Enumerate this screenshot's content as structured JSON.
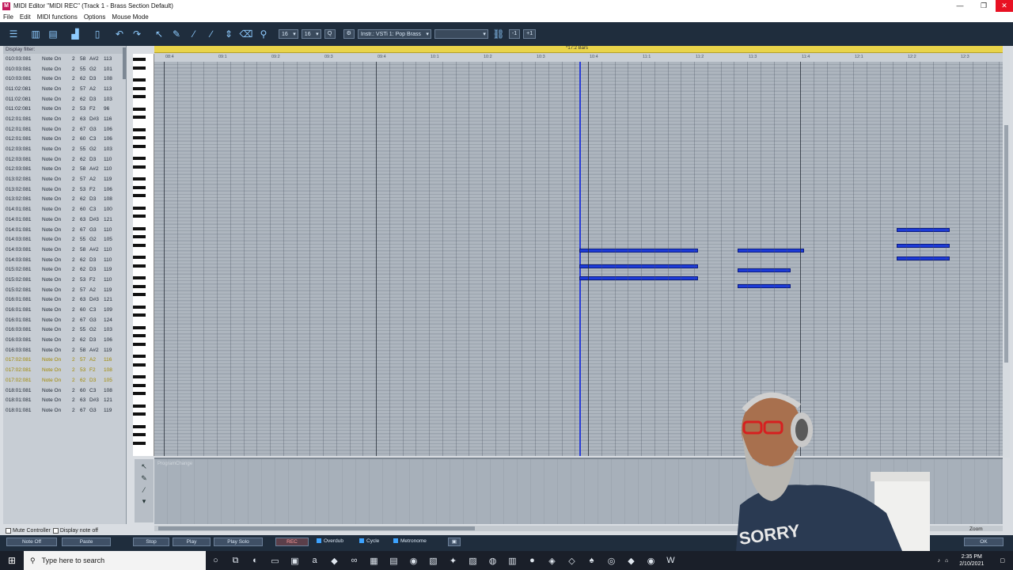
{
  "window": {
    "title": "MIDI Editor \"MIDI REC\"  (Track 1 - Brass Section Default)",
    "app_icon": "M"
  },
  "menu": [
    "File",
    "Edit",
    "MIDI functions",
    "Options",
    "Mouse Mode"
  ],
  "toolbar": {
    "quantize_1": "16",
    "quantize_2": "16",
    "q_label": "Q",
    "instrument": "Instr.: VSTi 1: Pop Brass",
    "blank_select": "",
    "minus": "-1",
    "plus": "+1"
  },
  "event_list": {
    "filter_label": "Display filter:",
    "rows": [
      [
        "010:03:081",
        "Note On",
        "2",
        "58",
        "A#2",
        "113"
      ],
      [
        "010:03:081",
        "Note On",
        "2",
        "55",
        "G2",
        "101"
      ],
      [
        "010:03:081",
        "Note On",
        "2",
        "62",
        "D3",
        "108"
      ],
      [
        "011:02:081",
        "Note On",
        "2",
        "57",
        "A2",
        "113"
      ],
      [
        "011:02:081",
        "Note On",
        "2",
        "62",
        "D3",
        "103"
      ],
      [
        "011:02:081",
        "Note On",
        "2",
        "53",
        "F2",
        "96"
      ],
      [
        "012:01:081",
        "Note On",
        "2",
        "63",
        "D#3",
        "116"
      ],
      [
        "012:01:081",
        "Note On",
        "2",
        "67",
        "G3",
        "106"
      ],
      [
        "012:01:081",
        "Note On",
        "2",
        "60",
        "C3",
        "106"
      ],
      [
        "012:03:081",
        "Note On",
        "2",
        "55",
        "G2",
        "103"
      ],
      [
        "012:03:081",
        "Note On",
        "2",
        "62",
        "D3",
        "110"
      ],
      [
        "012:03:081",
        "Note On",
        "2",
        "58",
        "A#2",
        "110"
      ],
      [
        "013:02:081",
        "Note On",
        "2",
        "57",
        "A2",
        "119"
      ],
      [
        "013:02:081",
        "Note On",
        "2",
        "53",
        "F2",
        "106"
      ],
      [
        "013:02:081",
        "Note On",
        "2",
        "62",
        "D3",
        "108"
      ],
      [
        "014:01:081",
        "Note On",
        "2",
        "60",
        "C3",
        "100"
      ],
      [
        "014:01:081",
        "Note On",
        "2",
        "63",
        "D#3",
        "121"
      ],
      [
        "014:01:081",
        "Note On",
        "2",
        "67",
        "G3",
        "110"
      ],
      [
        "014:03:081",
        "Note On",
        "2",
        "55",
        "G2",
        "105"
      ],
      [
        "014:03:081",
        "Note On",
        "2",
        "58",
        "A#2",
        "110"
      ],
      [
        "014:03:081",
        "Note On",
        "2",
        "62",
        "D3",
        "110"
      ],
      [
        "015:02:081",
        "Note On",
        "2",
        "62",
        "D3",
        "119"
      ],
      [
        "015:02:081",
        "Note On",
        "2",
        "53",
        "F2",
        "110"
      ],
      [
        "015:02:081",
        "Note On",
        "2",
        "57",
        "A2",
        "119"
      ],
      [
        "016:01:081",
        "Note On",
        "2",
        "63",
        "D#3",
        "121"
      ],
      [
        "016:01:081",
        "Note On",
        "2",
        "60",
        "C3",
        "109"
      ],
      [
        "016:01:081",
        "Note On",
        "2",
        "67",
        "G3",
        "124"
      ],
      [
        "016:03:081",
        "Note On",
        "2",
        "55",
        "G2",
        "103"
      ],
      [
        "016:03:081",
        "Note On",
        "2",
        "62",
        "D3",
        "106"
      ],
      [
        "016:03:081",
        "Note On",
        "2",
        "58",
        "A#2",
        "119"
      ],
      [
        "017:02:081",
        "Note On",
        "2",
        "57",
        "A2",
        "116"
      ],
      [
        "017:02:081",
        "Note On",
        "2",
        "53",
        "F2",
        "108"
      ],
      [
        "017:02:081",
        "Note On",
        "2",
        "62",
        "D3",
        "105"
      ],
      [
        "018:01:081",
        "Note On",
        "2",
        "60",
        "C3",
        "108"
      ],
      [
        "018:01:081",
        "Note On",
        "2",
        "63",
        "D#3",
        "121"
      ],
      [
        "018:01:081",
        "Note On",
        "2",
        "67",
        "G3",
        "119"
      ]
    ],
    "mute_controller": "Mute Controller",
    "display_note_off": "Display note off"
  },
  "ruler": {
    "range_label": "*17:2 Bars",
    "ticks": [
      "08:4",
      "09:1",
      "09:2",
      "09:3",
      "09:4",
      "10:1",
      "10:2",
      "10:3",
      "10:4",
      "11:1",
      "11:2",
      "11:3",
      "11:4",
      "12:1",
      "12:2",
      "12:3"
    ]
  },
  "controller_lane": {
    "label": "ProgramChange"
  },
  "transport": {
    "note_off": "Note Off",
    "paste": "Paste",
    "stop": "Stop",
    "play": "Play",
    "play_solo": "Play Solo",
    "rec": "REC",
    "overdub": "Overdub",
    "cycle": "Cycle",
    "metronome": "Metronome",
    "zoom": "Zoom",
    "ok": "OK"
  },
  "taskbar": {
    "search_placeholder": "Type here to search",
    "time": "2:35 PM",
    "date": "2/10/2021"
  }
}
